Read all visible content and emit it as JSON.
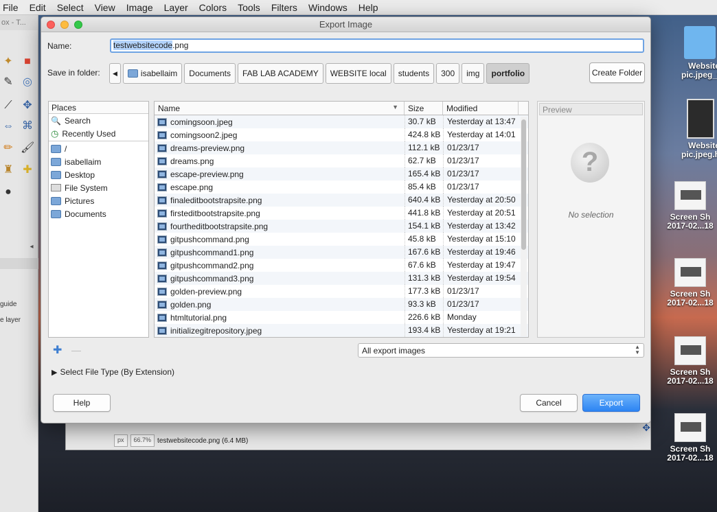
{
  "menubar": {
    "items": [
      "File",
      "Edit",
      "Select",
      "View",
      "Image",
      "Layer",
      "Colors",
      "Tools",
      "Filters",
      "Windows",
      "Help"
    ]
  },
  "toolbox": {
    "title": "ox - T...",
    "labels": [
      "guide",
      "e layer"
    ]
  },
  "image_window": {
    "unit": "px",
    "zoom": "66.7%",
    "status": "testwebsitecode.png (6.4 MB)"
  },
  "desktop_icons": [
    {
      "label": "Website pic.jpeg_f..."
    },
    {
      "label": "Website pic.jpeg.h..."
    },
    {
      "label": "Screen Sh 2017-02...18"
    },
    {
      "label": "Screen Sh 2017-02...18"
    },
    {
      "label": "Screen Sh 2017-02...18"
    },
    {
      "label": "Screen Sh 2017-02...18"
    }
  ],
  "dialog": {
    "title": "Export Image",
    "name_label": "Name:",
    "name_selected": "testwebsitecode",
    "name_ext": ".png",
    "save_in_label": "Save in folder:",
    "crumbs": [
      "isabellaim",
      "Documents",
      "FAB LAB ACADEMY",
      "WEBSITE local",
      "students",
      "300",
      "img",
      "portfolio"
    ],
    "create_folder": "Create Folder",
    "places_header": "Places",
    "places": [
      "Search",
      "Recently Used",
      "/",
      "isabellaim",
      "Desktop",
      "File System",
      "Pictures",
      "Documents"
    ],
    "columns": {
      "name": "Name",
      "size": "Size",
      "modified": "Modified"
    },
    "files": [
      {
        "name": "comingsoon.jpeg",
        "size": "30.7 kB",
        "modified": "Yesterday at 13:47"
      },
      {
        "name": "comingsoon2.jpeg",
        "size": "424.8 kB",
        "modified": "Yesterday at 14:01"
      },
      {
        "name": "dreams-preview.png",
        "size": "112.1 kB",
        "modified": "01/23/17"
      },
      {
        "name": "dreams.png",
        "size": "62.7 kB",
        "modified": "01/23/17"
      },
      {
        "name": "escape-preview.png",
        "size": "165.4 kB",
        "modified": "01/23/17"
      },
      {
        "name": "escape.png",
        "size": "85.4 kB",
        "modified": "01/23/17"
      },
      {
        "name": "finaleditbootstrapsite.png",
        "size": "640.4 kB",
        "modified": "Yesterday at 20:50"
      },
      {
        "name": "firsteditbootstrapsite.png",
        "size": "441.8 kB",
        "modified": "Yesterday at 20:51"
      },
      {
        "name": "fourtheditbootstrapsite.png",
        "size": "154.1 kB",
        "modified": "Yesterday at 13:42"
      },
      {
        "name": "gitpushcommand.png",
        "size": "45.8 kB",
        "modified": "Yesterday at 15:10"
      },
      {
        "name": "gitpushcommand1.png",
        "size": "167.6 kB",
        "modified": "Yesterday at 19:46"
      },
      {
        "name": "gitpushcommand2.png",
        "size": "67.6 kB",
        "modified": "Yesterday at 19:47"
      },
      {
        "name": "gitpushcommand3.png",
        "size": "131.3 kB",
        "modified": "Yesterday at 19:54"
      },
      {
        "name": "golden-preview.png",
        "size": "177.3 kB",
        "modified": "01/23/17"
      },
      {
        "name": "golden.png",
        "size": "93.3 kB",
        "modified": "01/23/17"
      },
      {
        "name": "htmltutorial.png",
        "size": "226.6 kB",
        "modified": "Monday"
      },
      {
        "name": "initializegitrepository.jpeg",
        "size": "193.4 kB",
        "modified": "Yesterday at 19:21"
      }
    ],
    "preview_header": "Preview",
    "no_selection": "No selection",
    "filter": "All export images",
    "file_type_toggle": "Select File Type (By Extension)",
    "help": "Help",
    "cancel": "Cancel",
    "export": "Export"
  }
}
